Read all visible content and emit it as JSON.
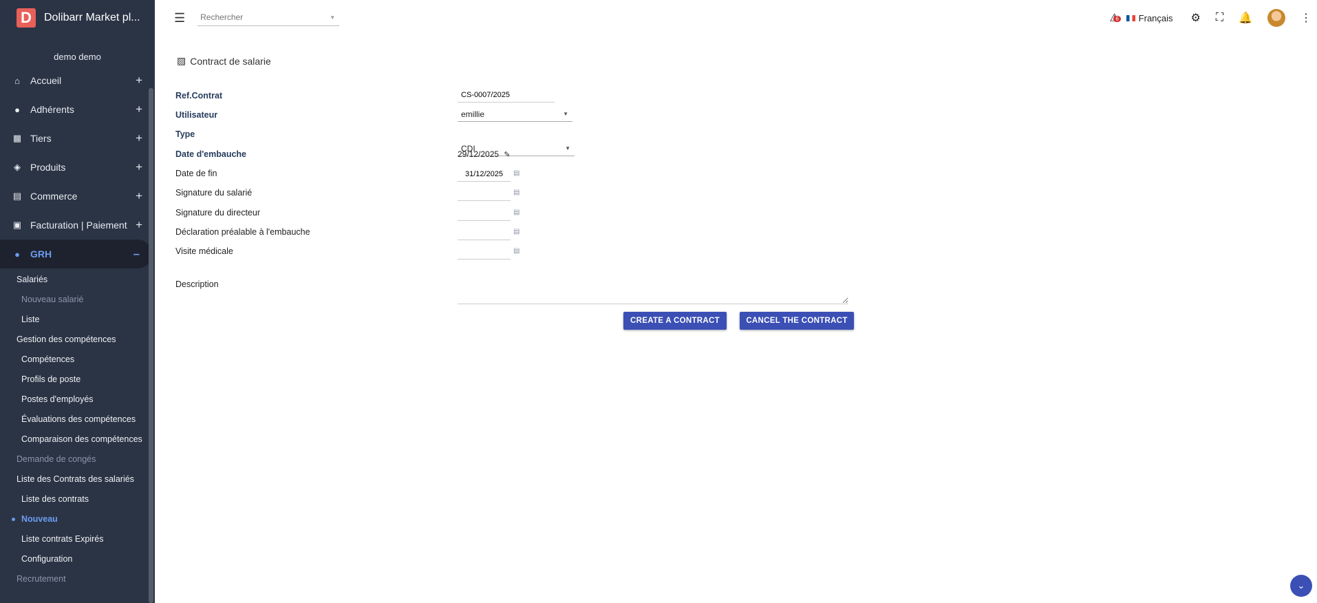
{
  "app": {
    "logo_letter": "D",
    "title": "Dolibarr Market pl..."
  },
  "sidebar": {
    "user": "demo demo",
    "menu": [
      {
        "icon": "⌂",
        "icon_name": "home-icon",
        "label": "Accueil",
        "toggle": "+"
      },
      {
        "icon": "●",
        "icon_name": "member-icon",
        "label": "Adhérents",
        "toggle": "+"
      },
      {
        "icon": "▦",
        "icon_name": "building-icon",
        "label": "Tiers",
        "toggle": "+"
      },
      {
        "icon": "◈",
        "icon_name": "box-icon",
        "label": "Produits",
        "toggle": "+"
      },
      {
        "icon": "▤",
        "icon_name": "commerce-icon",
        "label": "Commerce",
        "toggle": "+"
      },
      {
        "icon": "▣",
        "icon_name": "billing-icon",
        "label": "Facturation | Paiement",
        "toggle": "+"
      },
      {
        "icon": "●",
        "icon_name": "hr-icon",
        "label": "GRH",
        "toggle": "–"
      }
    ],
    "submenu": [
      "Salariés",
      "Nouveau salarié",
      "Liste",
      "Gestion des compétences",
      "Compétences",
      "Profils de poste",
      "Postes d'employés",
      "Évaluations des compétences",
      "Comparaison des compétences",
      "Demande de congés",
      "Liste des Contrats des salariés",
      "Liste des contrats",
      "Nouveau",
      "Liste contrats Expirés",
      "Configuration",
      "Recrutement"
    ]
  },
  "topbar": {
    "search_placeholder": "Rechercher",
    "language": "Français",
    "notification_count": "6"
  },
  "page": {
    "title": "Contract de salarie",
    "labels": {
      "ref": "Ref.Contrat",
      "user": "Utilisateur",
      "type": "Type",
      "hire_date": "Date d'embauche",
      "end_date": "Date de fin",
      "sig_employee": "Signature du salarié",
      "sig_director": "Signature du directeur",
      "declaration": "Déclaration préalable à l'embauche",
      "medical": "Visite médicale",
      "description": "Description"
    },
    "values": {
      "ref": "CS-0007/2025",
      "user": "emillie",
      "type": "CDI",
      "hire_date": "29/12/2025",
      "end_date": "31/12/2025",
      "sig_employee": "",
      "sig_director": "",
      "declaration": "",
      "medical": "",
      "description": ""
    },
    "buttons": {
      "create": "CREATE A CONTRACT",
      "cancel": "CANCEL THE CONTRACT"
    }
  },
  "colors": {
    "sidebar": "#2b3445",
    "accent": "#3b4fb5",
    "active_menu": "#6c9bef",
    "logo": "#e8605a"
  }
}
